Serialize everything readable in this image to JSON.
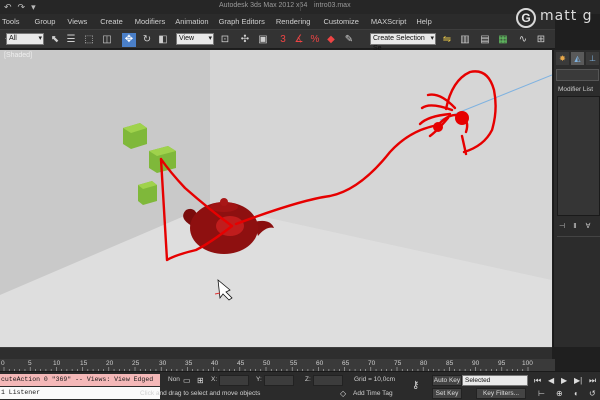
{
  "window": {
    "app_title": "Autodesk 3ds Max  2012 x64",
    "file_title": "intro03.max"
  },
  "watermark": {
    "logo_letter": "G",
    "text": "matt g"
  },
  "menu": {
    "items": [
      "Tools",
      "Group",
      "Views",
      "Create",
      "Modifiers",
      "Animation",
      "Graph Editors",
      "Rendering",
      "Customize",
      "MAXScript",
      "Help"
    ]
  },
  "toolbar": {
    "filter_value": "All",
    "ref_coord_value": "View",
    "selection_set_value": "Create Selection Se"
  },
  "viewport": {
    "label": "[Shaded]"
  },
  "command_panel": {
    "modifier_list": "Modifier List"
  },
  "timeline": {
    "ticks": [
      "0",
      "5",
      "10",
      "15",
      "20",
      "25",
      "30",
      "35",
      "40",
      "45",
      "50",
      "55",
      "60",
      "65",
      "70",
      "75",
      "80",
      "85",
      "90",
      "95",
      "100"
    ]
  },
  "status": {
    "maxscript_line": "cuteAction 0 \"369\"  -- Views: View Edged",
    "listener": "1 Listener",
    "selection": "Non",
    "prompt": "Click and drag to select and move objects",
    "x_label": "X:",
    "y_label": "Y:",
    "z_label": "Z:",
    "grid": "Grid = 10,0cm",
    "add_time_tag": "Add Time Tag",
    "auto_key": "Auto Key",
    "set_key": "Set Key",
    "key_dropdown": "Selected",
    "key_filters": "Key Filters..."
  }
}
